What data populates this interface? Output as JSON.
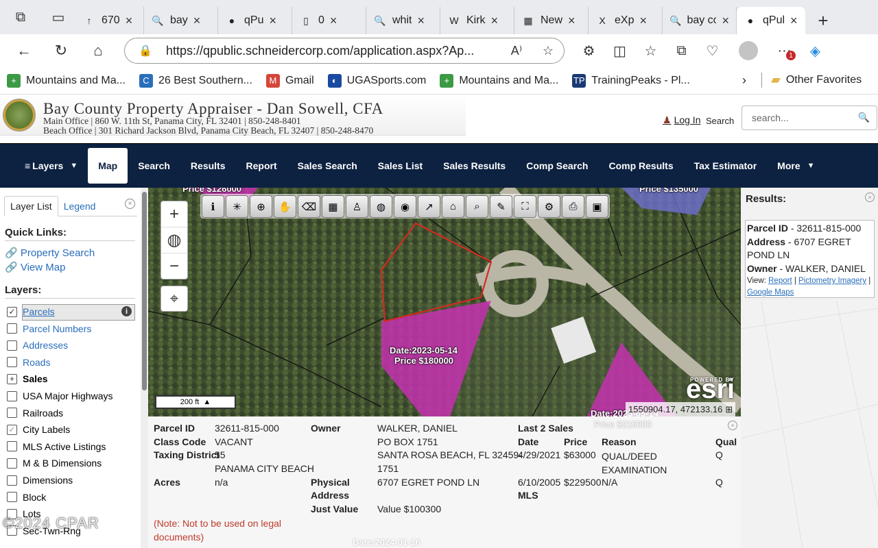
{
  "browser": {
    "tabs": [
      {
        "label": "670",
        "icon": "↑",
        "active": false
      },
      {
        "label": "bay",
        "icon": "🔍",
        "active": false
      },
      {
        "label": "qPu",
        "icon": "●",
        "active": false
      },
      {
        "label": "0",
        "icon": "▯",
        "active": false
      },
      {
        "label": "whit",
        "icon": "🔍",
        "active": false
      },
      {
        "label": "Kirk",
        "icon": "W",
        "active": false
      },
      {
        "label": "New",
        "icon": "▦",
        "active": false
      },
      {
        "label": "eXp",
        "icon": "X",
        "active": false
      },
      {
        "label": "bay cou",
        "icon": "🔍",
        "active": false
      },
      {
        "label": "qPul",
        "icon": "●",
        "active": true
      }
    ],
    "url": "https://qpublic.schneidercorp.com/application.aspx?Ap...",
    "favorites": [
      {
        "label": "Mountains and Ma...",
        "icon": "+",
        "color": "#3c9a45"
      },
      {
        "label": "26 Best Southern...",
        "icon": "C",
        "color": "#2a6ebb"
      },
      {
        "label": "Gmail",
        "icon": "M",
        "color": "#d44638"
      },
      {
        "label": "UGASports.com",
        "icon": "◐",
        "color": "#1a4aa0"
      },
      {
        "label": "Mountains and Ma...",
        "icon": "+",
        "color": "#3c9a45"
      },
      {
        "label": "TrainingPeaks - Pl...",
        "icon": "TP",
        "color": "#1b3a73"
      }
    ],
    "other_favorites": "Other Favorites",
    "notification_count": "1"
  },
  "site": {
    "title": "Bay County Property Appraiser - Dan Sowell, CFA",
    "main_office": "Main Office | 860 W. 11th St, Panama City, FL 32401 | 850-248-8401",
    "beach_office": "Beach Office | 301 Richard Jackson Blvd, Panama City Beach, FL 32407 | 850-248-8470",
    "login": "Log In",
    "search_label": "Search",
    "search_placeholder": "search..."
  },
  "nav": {
    "items": [
      "Layers",
      "Map",
      "Search",
      "Results",
      "Report",
      "Sales Search",
      "Sales List",
      "Sales Results",
      "Comp Search",
      "Comp Results",
      "Tax Estimator",
      "More"
    ],
    "active": "Map"
  },
  "left_panel": {
    "tab_layer_list": "Layer List",
    "tab_legend": "Legend",
    "quick_links_heading": "Quick Links:",
    "link_property_search": "Property Search",
    "link_view_map": "View Map",
    "layers_heading": "Layers:",
    "layers": [
      {
        "label": "Parcels",
        "checked": true,
        "style": "link"
      },
      {
        "label": "Parcel Numbers",
        "checked": false,
        "style": "link"
      },
      {
        "label": "Addresses",
        "checked": false,
        "style": "link"
      },
      {
        "label": "Roads",
        "checked": false,
        "style": "link"
      },
      {
        "label": "Sales",
        "checked": false,
        "style": "bold"
      },
      {
        "label": "USA Major Highways",
        "checked": false,
        "style": "plain"
      },
      {
        "label": "Railroads",
        "checked": false,
        "style": "plain"
      },
      {
        "label": "City Labels",
        "checked": true,
        "style": "plain"
      },
      {
        "label": "MLS Active Listings",
        "checked": false,
        "style": "plain"
      },
      {
        "label": "M & B Dimensions",
        "checked": false,
        "style": "plain"
      },
      {
        "label": "Dimensions",
        "checked": false,
        "style": "plain"
      },
      {
        "label": "Block",
        "checked": false,
        "style": "plain"
      },
      {
        "label": "Lots",
        "checked": false,
        "style": "plain"
      },
      {
        "label": "Sec-Twn-Rng",
        "checked": false,
        "style": "plain"
      }
    ],
    "watermark": "©2024 CPAR"
  },
  "map": {
    "labels": {
      "top_left": "Price $126000",
      "top_right": "Price $135000",
      "sale_date": "Date:2023-05-14",
      "sale_price": "Price $180000",
      "right_date": "Date:2023-05-14",
      "right_price": "Price $215000",
      "bottom_date": "Date:2024-01-16"
    },
    "scale": "200 ft",
    "esri_powered": "POWERED BY",
    "esri": "esri",
    "coords": "1550904.17, 472133.16"
  },
  "parcel_info": {
    "parcel_id_label": "Parcel ID",
    "parcel_id": "32611-815-000",
    "class_code_label": "Class Code",
    "class_code": "VACANT",
    "taxing_district_label": "Taxing District",
    "taxing_district": "55",
    "taxing_district_name": "PANAMA CITY BEACH",
    "acres_label": "Acres",
    "acres": "n/a",
    "owner_label": "Owner",
    "owner": "WALKER, DANIEL",
    "owner_addr1": "PO BOX 1751",
    "owner_addr2": "SANTA ROSA BEACH, FL 32459-",
    "owner_addr3": "1751",
    "physical_label1": "Physical",
    "physical_label2": "Address",
    "physical_address": "6707 EGRET POND LN",
    "just_value_label": "Just Value",
    "just_value": "Value $100300",
    "note": "(Note: Not to be used on legal documents)",
    "sales_heading": "Last 2 Sales",
    "sales_cols": {
      "date": "Date",
      "price": "Price",
      "reason": "Reason",
      "qual": "Qual"
    },
    "sales": [
      {
        "date": "4/29/2021",
        "price": "$63000",
        "reason": "QUAL/DEED EXAMINATION",
        "qual": "Q"
      },
      {
        "date": "6/10/2005",
        "price": "$229500",
        "reason": "N/A",
        "qual": "Q"
      }
    ],
    "mls_label": "MLS"
  },
  "results": {
    "title": "Results:",
    "parcel_id_label": "Parcel ID",
    "parcel_id": "32611-815-000",
    "address_label": "Address",
    "address": "6707 EGRET POND LN",
    "owner_label": "Owner",
    "owner": "WALKER, DANIEL",
    "view_label": "View:",
    "links": [
      "Report",
      "Pictometry Imagery",
      "Google Maps"
    ]
  }
}
